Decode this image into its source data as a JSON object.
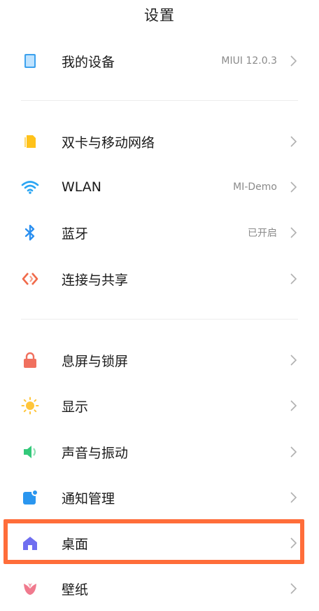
{
  "header": {
    "title": "设置"
  },
  "sections": {
    "device": {
      "label": "我的设备",
      "value": "MIUI 12.0.3",
      "icon": "device-icon"
    },
    "sim": {
      "label": "双卡与移动网络",
      "icon": "sim-card-icon"
    },
    "wlan": {
      "label": "WLAN",
      "value": "MI-Demo",
      "icon": "wifi-icon"
    },
    "bluetooth": {
      "label": "蓝牙",
      "value": "已开启",
      "icon": "bluetooth-icon"
    },
    "share": {
      "label": "连接与共享",
      "icon": "share-icon"
    },
    "lock": {
      "label": "息屏与锁屏",
      "icon": "lock-icon"
    },
    "display": {
      "label": "显示",
      "icon": "sun-icon"
    },
    "sound": {
      "label": "声音与振动",
      "icon": "speaker-icon"
    },
    "notify": {
      "label": "通知管理",
      "icon": "notification-icon"
    },
    "desktop": {
      "label": "桌面",
      "icon": "home-icon"
    },
    "wallpaper": {
      "label": "壁纸",
      "icon": "flower-icon"
    }
  },
  "colors": {
    "highlight": "#ff6d3a",
    "device": "#3da2ee",
    "sim": "#ffc21a",
    "wifi": "#2aa5f3",
    "bluetooth": "#2a8ff0",
    "share": "#f06a4a",
    "lock": "#f0705e",
    "sun": "#ffc53a",
    "sound": "#33c97a",
    "notify": "#2a96ef",
    "home": "#6f6ef0",
    "flower": "#f07a8e"
  }
}
